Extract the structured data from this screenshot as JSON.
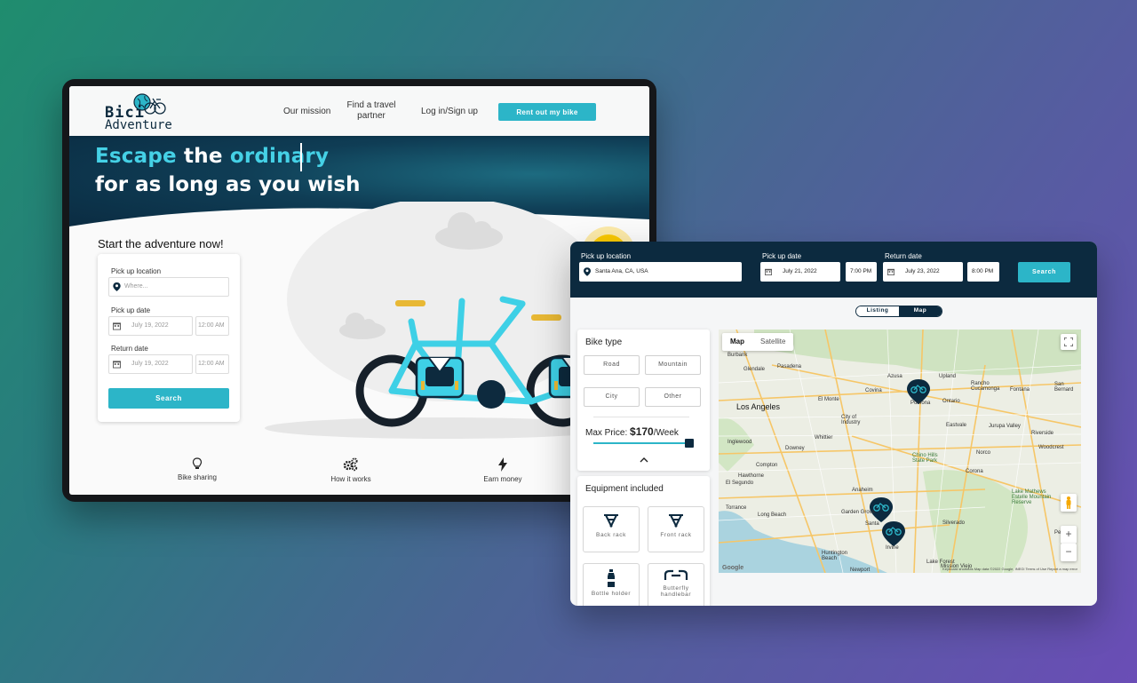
{
  "landing": {
    "logo": {
      "line1": "Bici",
      "line2": "Adventure"
    },
    "nav": {
      "mission": "Our mission",
      "partner": "Find a travel partner",
      "login": "Log in/Sign up",
      "rent": "Rent out my bike"
    },
    "hero": {
      "w1": "Escape",
      "w2": "the",
      "w3": "ordinary",
      "line2": "for as long as you wish"
    },
    "form": {
      "title": "Start the adventure now!",
      "location_label": "Pick up location",
      "location_placeholder": "Where...",
      "pickup_label": "Pick up date",
      "pickup_date": "July 19, 2022",
      "pickup_time": "12:00 AM",
      "return_label": "Return date",
      "return_date": "July 19, 2022",
      "return_time": "12:00 AM",
      "search": "Search"
    },
    "features": [
      {
        "label": "Bike sharing",
        "icon": "lightbulb-icon"
      },
      {
        "label": "How it works",
        "icon": "gears-icon"
      },
      {
        "label": "Earn money",
        "icon": "lightning-icon"
      }
    ]
  },
  "search_page": {
    "header": {
      "location_label": "Pick up location",
      "location_value": "Santa Ana, CA, USA",
      "pickup_label": "Pick up date",
      "pickup_date": "July 21, 2022",
      "pickup_time": "7:00 PM",
      "return_label": "Return date",
      "return_date": "July 23, 2022",
      "return_time": "8:00 PM",
      "search": "Search"
    },
    "view_toggle": {
      "listing": "Listing",
      "map": "Map",
      "active": "Map"
    },
    "filters": {
      "bike_type_title": "Bike type",
      "bike_types": [
        "Road",
        "Mountain",
        "City",
        "Other"
      ],
      "max_price_label": "Max Price:",
      "max_price_value": "$170",
      "max_price_unit": "/Week",
      "equipment_title": "Equipment included",
      "equipment": [
        {
          "label": "Back rack",
          "icon": "back-rack-icon"
        },
        {
          "label": "Front rack",
          "icon": "front-rack-icon"
        },
        {
          "label": "Bottle holder",
          "icon": "bottle-icon"
        },
        {
          "label": "Butterfly handlebar",
          "icon": "handlebar-icon"
        }
      ]
    },
    "map": {
      "tabs": [
        "Map",
        "Satellite"
      ],
      "active_tab": "Map",
      "cities": {
        "la": "Los Angeles",
        "pomona": "Pomona",
        "anaheim": "Anaheim",
        "long_beach": "Long Beach",
        "santa": "Santa",
        "irvine": "Irvine",
        "riverside": "Riverside",
        "glendale": "Glendale",
        "pasadena": "Pasadena",
        "burbank": "Burbank",
        "san_bernardino": "San Bernard",
        "ontario": "Ontario",
        "chino_hills": "Chino Hills State Park",
        "huntington": "Huntington Beach",
        "norco": "Norco",
        "corona": "Corona",
        "lake_mathews": "Lake Mathews Estelle Mountain Reserve",
        "fontana": "Fontana",
        "covina": "Covina",
        "torrance": "Torrance",
        "downey": "Downey",
        "whittier": "Whittier",
        "el_monte": "El Monte",
        "compton": "Compton",
        "azusa": "Azusa",
        "garden_grove": "Garden Grove",
        "newport": "Newport",
        "lake_forest": "Lake Forest",
        "mission_viejo": "Mission Viejo",
        "silverado": "Silverado",
        "perris": "Perris",
        "woodcrest": "Woodcrest",
        "eastvale": "Eastvale",
        "jurupa": "Jurupa Valley",
        "upland": "Upland",
        "rancho": "Rancho Cucamonga",
        "city_industry": "City of Industry",
        "el_segundo": "El Segundo",
        "hawthorne": "Hawthorne",
        "inglewood": "Inglewood"
      },
      "google": "Google",
      "footer": "Keyboard shortcuts   Map data ©2022 Google, INEGI   Terms of Use   Report a map error"
    }
  },
  "colors": {
    "accent": "#2cb5c8",
    "navy": "#0c2a3f",
    "hero_accent": "#45d1e6"
  }
}
